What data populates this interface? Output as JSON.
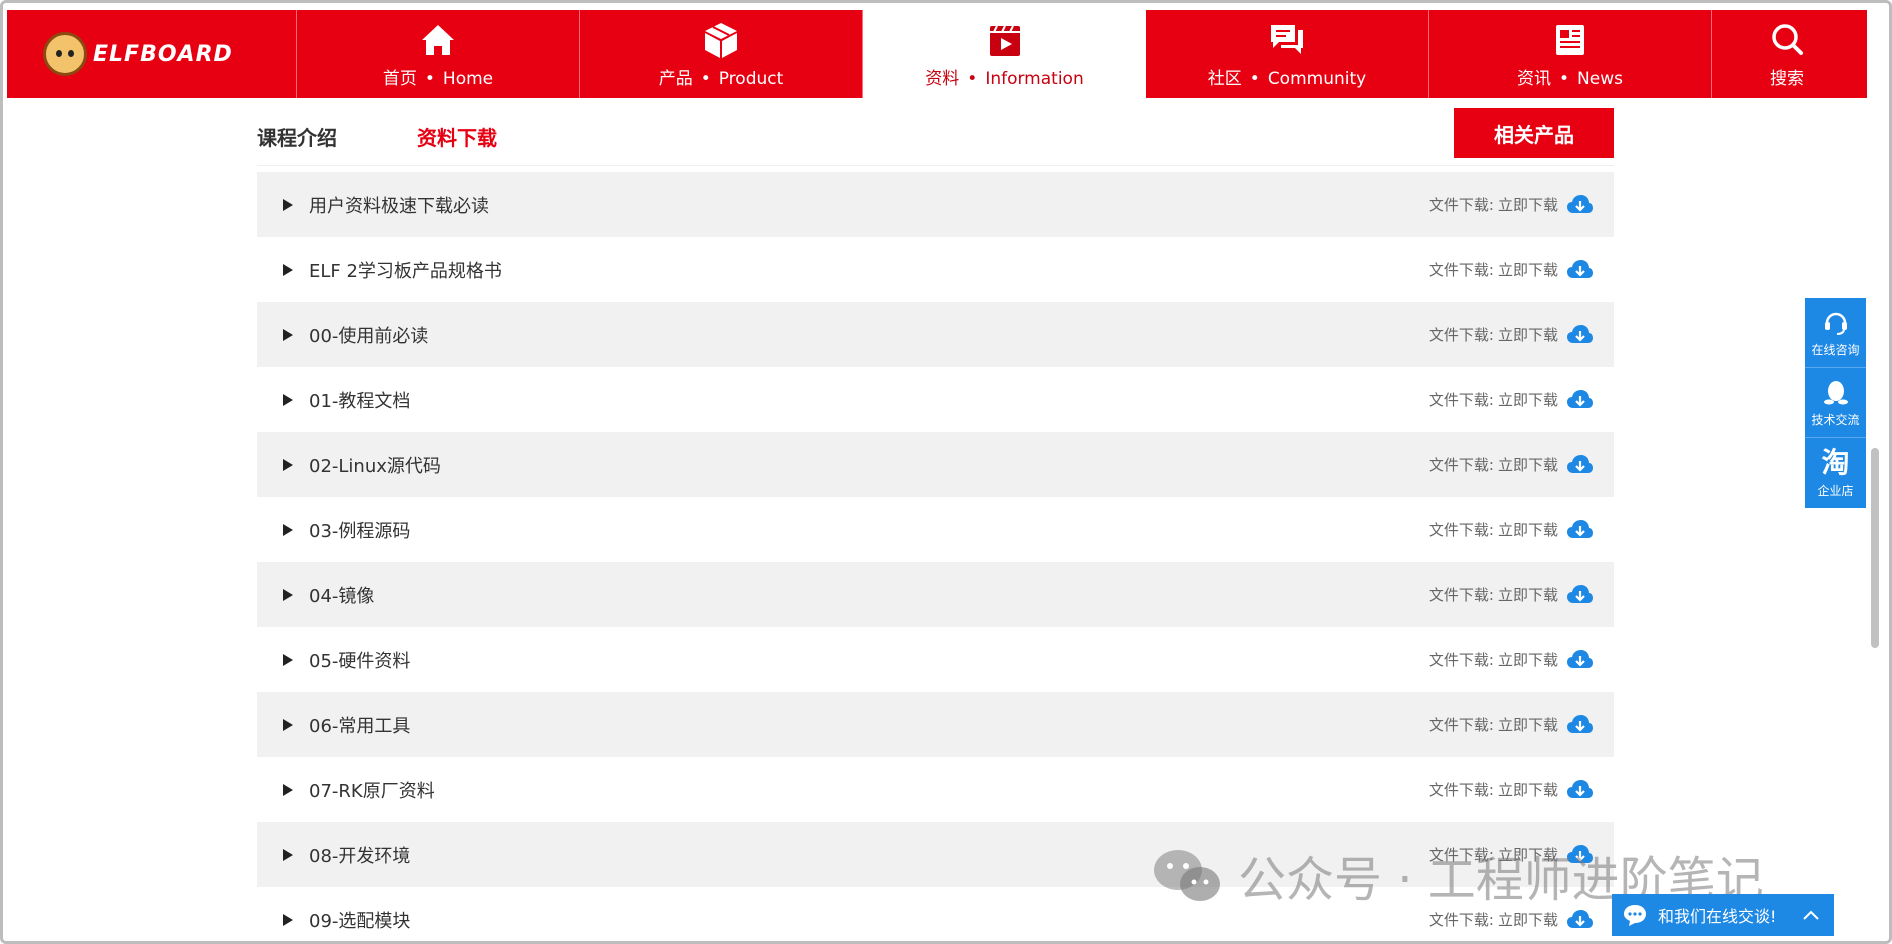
{
  "brand": {
    "name": "ELFBOARD"
  },
  "nav": {
    "items": [
      {
        "cn": "首页",
        "en": "Home",
        "icon": "home-icon"
      },
      {
        "cn": "产品",
        "en": "Product",
        "icon": "box-icon"
      },
      {
        "cn": "资料",
        "en": "Information",
        "icon": "video-icon",
        "active": true
      },
      {
        "cn": "社区",
        "en": "Community",
        "icon": "chat-bubbles-icon"
      },
      {
        "cn": "资讯",
        "en": "News",
        "icon": "newspaper-icon"
      }
    ],
    "separator": "•",
    "search_label": "搜索"
  },
  "tabs": {
    "intro": "课程介绍",
    "download": "资料下载",
    "related_button": "相关产品"
  },
  "list": {
    "download_label": "文件下载:",
    "download_link": "立即下载",
    "items": [
      "用户资料极速下载必读",
      "ELF 2学习板产品规格书",
      "00-使用前必读",
      "01-教程文档",
      "02-Linux源代码",
      "03-例程源码",
      "04-镜像",
      "05-硬件资料",
      "06-常用工具",
      "07-RK原厂资料",
      "08-开发环境",
      "09-选配模块"
    ]
  },
  "side": {
    "consult": "在线咨询",
    "tech": "技术交流",
    "tao_glyph": "淘",
    "shop": "企业店"
  },
  "watermark": {
    "text": "公众号 · 工程师进阶笔记"
  },
  "chat": {
    "label": "和我们在线交谈!"
  },
  "colors": {
    "brand_red": "#e60012",
    "accent_blue": "#1e88e5",
    "stripe": "#f1f1f1"
  }
}
